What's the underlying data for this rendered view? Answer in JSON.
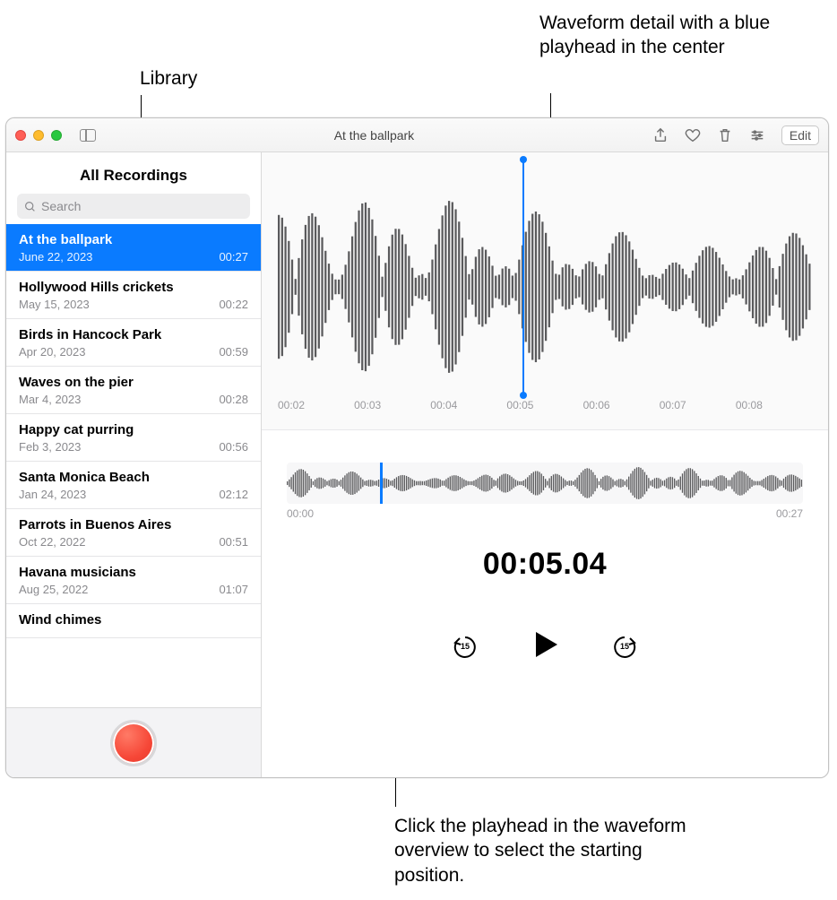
{
  "annotations": {
    "library": "Library",
    "waveform_detail": "Waveform detail with a blue playhead in the center",
    "overview_hint": "Click the playhead in the waveform overview to select the starting position."
  },
  "window": {
    "title": "At the ballpark",
    "edit_label": "Edit"
  },
  "sidebar": {
    "header": "All Recordings",
    "search_placeholder": "Search",
    "items": [
      {
        "title": "At the ballpark",
        "date": "June 22, 2023",
        "duration": "00:27",
        "selected": true
      },
      {
        "title": "Hollywood Hills crickets",
        "date": "May 15, 2023",
        "duration": "00:22"
      },
      {
        "title": "Birds in Hancock Park",
        "date": "Apr 20, 2023",
        "duration": "00:59"
      },
      {
        "title": "Waves on the pier",
        "date": "Mar 4, 2023",
        "duration": "00:28"
      },
      {
        "title": "Happy cat purring",
        "date": "Feb 3, 2023",
        "duration": "00:56"
      },
      {
        "title": "Santa Monica Beach",
        "date": "Jan 24, 2023",
        "duration": "02:12"
      },
      {
        "title": "Parrots in Buenos Aires",
        "date": "Oct 22, 2022",
        "duration": "00:51"
      },
      {
        "title": "Havana musicians",
        "date": "Aug 25, 2022",
        "duration": "01:07"
      },
      {
        "title": "Wind chimes",
        "date": "",
        "duration": ""
      }
    ]
  },
  "detail": {
    "ticks": [
      "00:02",
      "00:03",
      "00:04",
      "00:05",
      "00:06",
      "00:07",
      "00:08"
    ],
    "overview_start": "00:00",
    "overview_end": "00:27",
    "current_time": "00:05.04",
    "skip_seconds": "15"
  }
}
